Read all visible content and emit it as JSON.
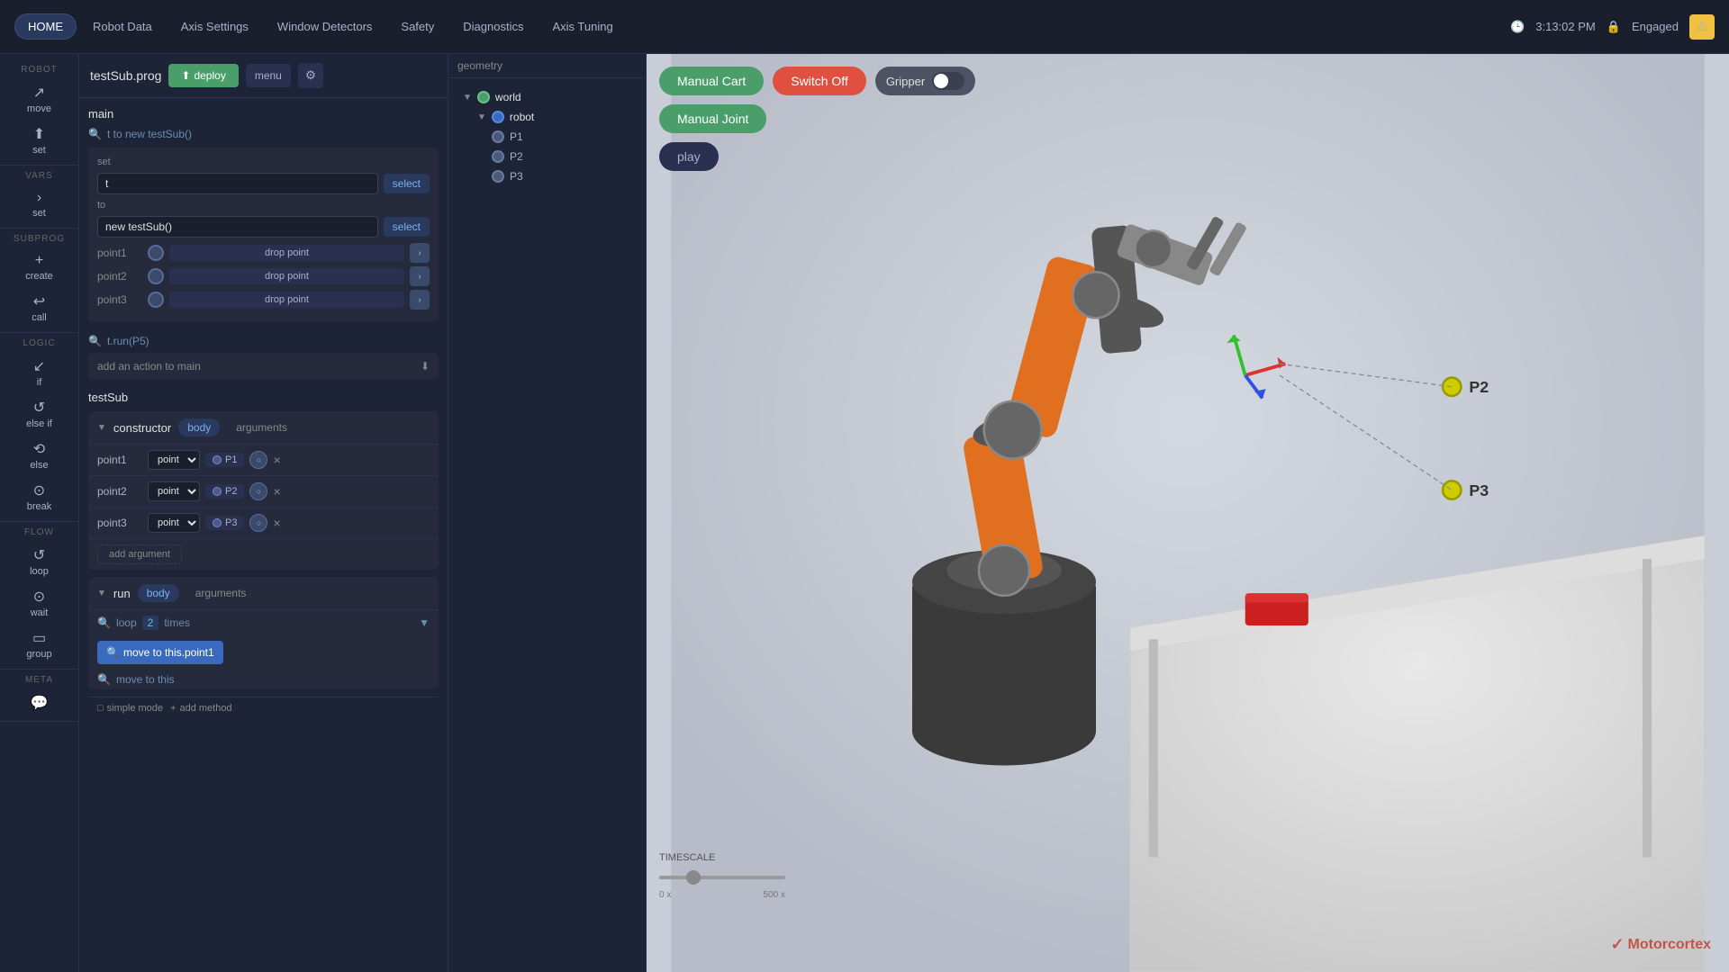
{
  "nav": {
    "items": [
      {
        "label": "HOME",
        "active": true
      },
      {
        "label": "Robot Data",
        "active": false
      },
      {
        "label": "Axis Settings",
        "active": false
      },
      {
        "label": "Window Detectors",
        "active": false
      },
      {
        "label": "Safety",
        "active": false
      },
      {
        "label": "Diagnostics",
        "active": false
      },
      {
        "label": "Axis Tuning",
        "active": false
      }
    ],
    "time": "3:13:02 PM",
    "status": "Engaged"
  },
  "program": {
    "title": "testSub.prog",
    "deploy_label": "deploy",
    "menu_label": "menu",
    "main_label": "main",
    "set_label": "set",
    "set_variable": "t",
    "set_to_label": "to",
    "set_to_value": "new testSub()",
    "select_label": "select",
    "search_text": "t to new testSub()",
    "points": [
      {
        "label": "point1",
        "action": "drop point"
      },
      {
        "label": "point2",
        "action": "drop point"
      },
      {
        "label": "point3",
        "action": "drop point"
      }
    ],
    "run_text": "t.run(P5)",
    "add_action_label": "add an action to main",
    "subsub_title": "testSub",
    "constructor_label": "constructor",
    "body_tab": "body",
    "arguments_tab": "arguments",
    "args": [
      {
        "name": "point1",
        "type": "point",
        "p_label": "P1"
      },
      {
        "name": "point2",
        "type": "point",
        "p_label": "P2"
      },
      {
        "name": "point3",
        "type": "point",
        "p_label": "P3"
      }
    ],
    "add_argument_label": "add argument",
    "run_label": "run",
    "run_body_tab": "body",
    "run_arguments_tab": "arguments",
    "loop_label": "loop",
    "loop_count": "2",
    "loop_times": "times",
    "move_label": "move to this.point1",
    "move_to_this": "move to this",
    "simple_mode": "simple mode",
    "add_method": "add method"
  },
  "world_tree": {
    "world_label": "world",
    "robot_label": "robot",
    "points": [
      "P1",
      "P2",
      "P3"
    ]
  },
  "geometry_label": "geometry",
  "viewport": {
    "manual_cart_label": "Manual Cart",
    "switch_off_label": "Switch Off",
    "manual_joint_label": "Manual Joint",
    "play_label": "play",
    "gripper_label": "Gripper",
    "timescale_label": "TIMESCALE",
    "timescale_min": "0 x",
    "timescale_max": "500 x",
    "point_labels": [
      "P2",
      "P3"
    ],
    "logo_text": "✓ Motorcortex"
  },
  "sidebar": {
    "sections": [
      {
        "label": "ROBOT",
        "items": [
          {
            "icon": "↗",
            "name": "move"
          },
          {
            "icon": "⬆",
            "name": "set"
          }
        ]
      },
      {
        "label": "VARS",
        "items": [
          {
            "icon": "›",
            "name": "set"
          }
        ]
      },
      {
        "label": "SUBPROG",
        "items": [
          {
            "icon": "+",
            "name": "create"
          },
          {
            "icon": "⟳",
            "name": "call"
          }
        ]
      },
      {
        "label": "LOGIC",
        "items": [
          {
            "icon": "↙",
            "name": "if"
          },
          {
            "icon": "↺",
            "name": "else if"
          },
          {
            "icon": "⟲",
            "name": "else"
          },
          {
            "icon": "⊙",
            "name": "break"
          }
        ]
      },
      {
        "label": "FLOW",
        "items": [
          {
            "icon": "↺",
            "name": "loop"
          },
          {
            "icon": "⊙",
            "name": "wait"
          },
          {
            "icon": "▭",
            "name": "group"
          }
        ]
      },
      {
        "label": "META",
        "items": [
          {
            "icon": "💬",
            "name": "comment"
          }
        ]
      }
    ]
  }
}
